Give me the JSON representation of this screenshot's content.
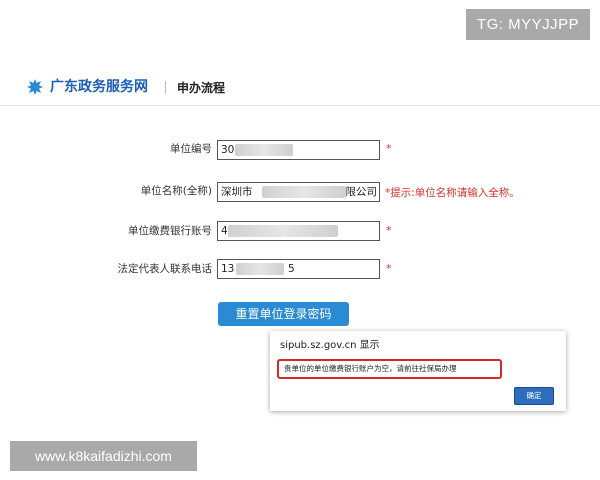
{
  "overlay": {
    "tg": "TG: MYYJJPP",
    "watermark": "www.k8kaifadizhi.com"
  },
  "header": {
    "site_name": "广东政务服务网",
    "page_title": "申办流程"
  },
  "form": {
    "fields": [
      {
        "label": "单位编号",
        "value": "30",
        "required_mark": "*"
      },
      {
        "label": "单位名称(全称)",
        "value": "深圳市",
        "value_tail": "限公司",
        "required_mark": "",
        "hint": "*提示:单位名称请输入全称。"
      },
      {
        "label": "单位缴费银行账号",
        "value": "4",
        "required_mark": "*"
      },
      {
        "label": "法定代表人联系电话",
        "value": "13",
        "value_tail": "5",
        "required_mark": "*"
      }
    ],
    "reset_button": "重置单位登录密码"
  },
  "dialog": {
    "title": "sipub.sz.gov.cn 显示",
    "message": "贵单位的单位缴费银行账户为空，请前往社保局办理",
    "ok_button": "确定"
  },
  "colors": {
    "brand": "#1a5fb4",
    "button": "#2a8ad4",
    "warning": "#d4342c"
  }
}
